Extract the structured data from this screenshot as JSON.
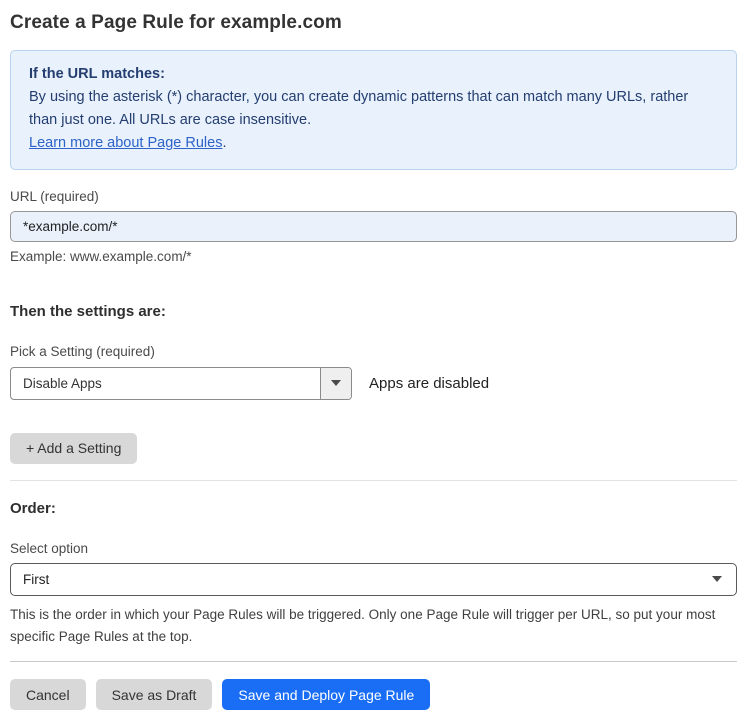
{
  "page": {
    "title": "Create a Page Rule for example.com"
  },
  "info_box": {
    "heading": "If the URL matches:",
    "body": "By using the asterisk (*) character, you can create dynamic patterns that can match many URLs, rather than just one. All URLs are case insensitive.",
    "link_label": "Learn more about Page Rules",
    "link_suffix": "."
  },
  "url_field": {
    "label": "URL (required)",
    "value": "*example.com/*",
    "helper": "Example: www.example.com/*"
  },
  "settings_section": {
    "heading": "Then the settings are:",
    "setting_label": "Pick a Setting (required)",
    "setting_value": "Disable Apps",
    "setting_description": "Apps are disabled",
    "add_setting_label": "+ Add a Setting"
  },
  "order_section": {
    "heading": "Order:",
    "select_label": "Select option",
    "select_value": "First",
    "description": "This is the order in which your Page Rules will be triggered. Only one Page Rule will trigger per URL, so put your most specific Page Rules at the top."
  },
  "footer": {
    "cancel_label": "Cancel",
    "save_draft_label": "Save as Draft",
    "save_deploy_label": "Save and Deploy Page Rule"
  },
  "colors": {
    "accent_blue": "#1a6ef5",
    "info_box_bg": "#e8f1fc",
    "info_box_border": "#b9d3ef",
    "info_text": "#243e70",
    "link_blue": "#2d63c8",
    "url_input_bg": "#eaf1fb",
    "gray_button_bg": "#d8d8d8"
  }
}
